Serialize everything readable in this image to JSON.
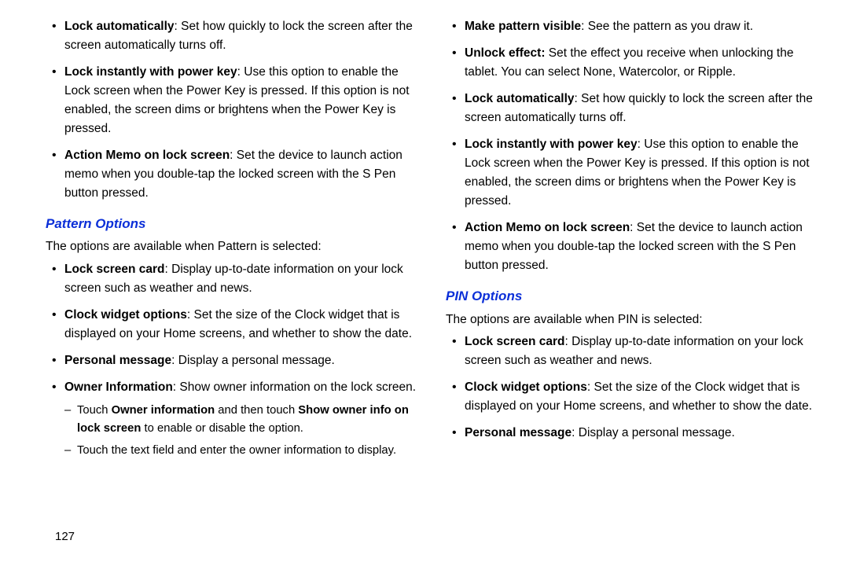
{
  "page_number": "127",
  "left": {
    "top_bullets": [
      {
        "term": "Lock automatically",
        "desc": ": Set how quickly to lock the screen after the screen automatically turns off."
      },
      {
        "term": "Lock instantly with power key",
        "desc": ": Use this option to enable the Lock screen when the Power Key is pressed. If this option is not enabled, the screen dims or brightens when the Power Key is pressed."
      },
      {
        "term": "Action Memo on lock screen",
        "desc": ": Set the device to launch action memo when you double-tap the locked screen with the S Pen button pressed."
      }
    ],
    "pattern_heading": "Pattern Options",
    "pattern_intro": "The options are available when Pattern is selected:",
    "pattern_bullets": [
      {
        "term": "Lock screen card",
        "desc": ": Display up-to-date information on your lock screen such as weather and news."
      },
      {
        "term": "Clock widget options",
        "desc": ": Set the size of the Clock widget that is displayed on your Home screens, and whether to show the date."
      },
      {
        "term": "Personal message",
        "desc": ": Display a personal message."
      },
      {
        "term": "Owner Information",
        "desc": ": Show owner information on the lock screen."
      }
    ],
    "owner_sub": [
      {
        "pre": "Touch ",
        "b1": "Owner information",
        "mid": " and then touch ",
        "b2": "Show owner info on lock screen",
        "post": " to enable or disable the option."
      },
      {
        "plain": "Touch the text field and enter the owner information to display."
      }
    ]
  },
  "right": {
    "top_bullets": [
      {
        "term": "Make pattern visible",
        "desc": ": See the pattern as you draw it."
      },
      {
        "term": "Unlock effect:",
        "desc": " Set the effect you receive when unlocking the tablet. You can select None, Watercolor, or Ripple."
      },
      {
        "term": "Lock automatically",
        "desc": ": Set how quickly to lock the screen after the screen automatically turns off."
      },
      {
        "term": "Lock instantly with power key",
        "desc": ": Use this option to enable the Lock screen when the Power Key is pressed. If this option is not enabled, the screen dims or brightens when the Power Key is pressed."
      },
      {
        "term": "Action Memo on lock screen",
        "desc": ": Set the device to launch action memo when you double-tap the locked screen with the S Pen button pressed."
      }
    ],
    "pin_heading": "PIN Options",
    "pin_intro": "The options are available when PIN is selected:",
    "pin_bullets": [
      {
        "term": "Lock screen card",
        "desc": ": Display up-to-date information on your lock screen such as weather and news."
      },
      {
        "term": "Clock widget options",
        "desc": ": Set the size of the Clock widget that is displayed on your Home screens, and whether to show the date."
      },
      {
        "term": "Personal message",
        "desc": ": Display a personal message."
      }
    ]
  }
}
